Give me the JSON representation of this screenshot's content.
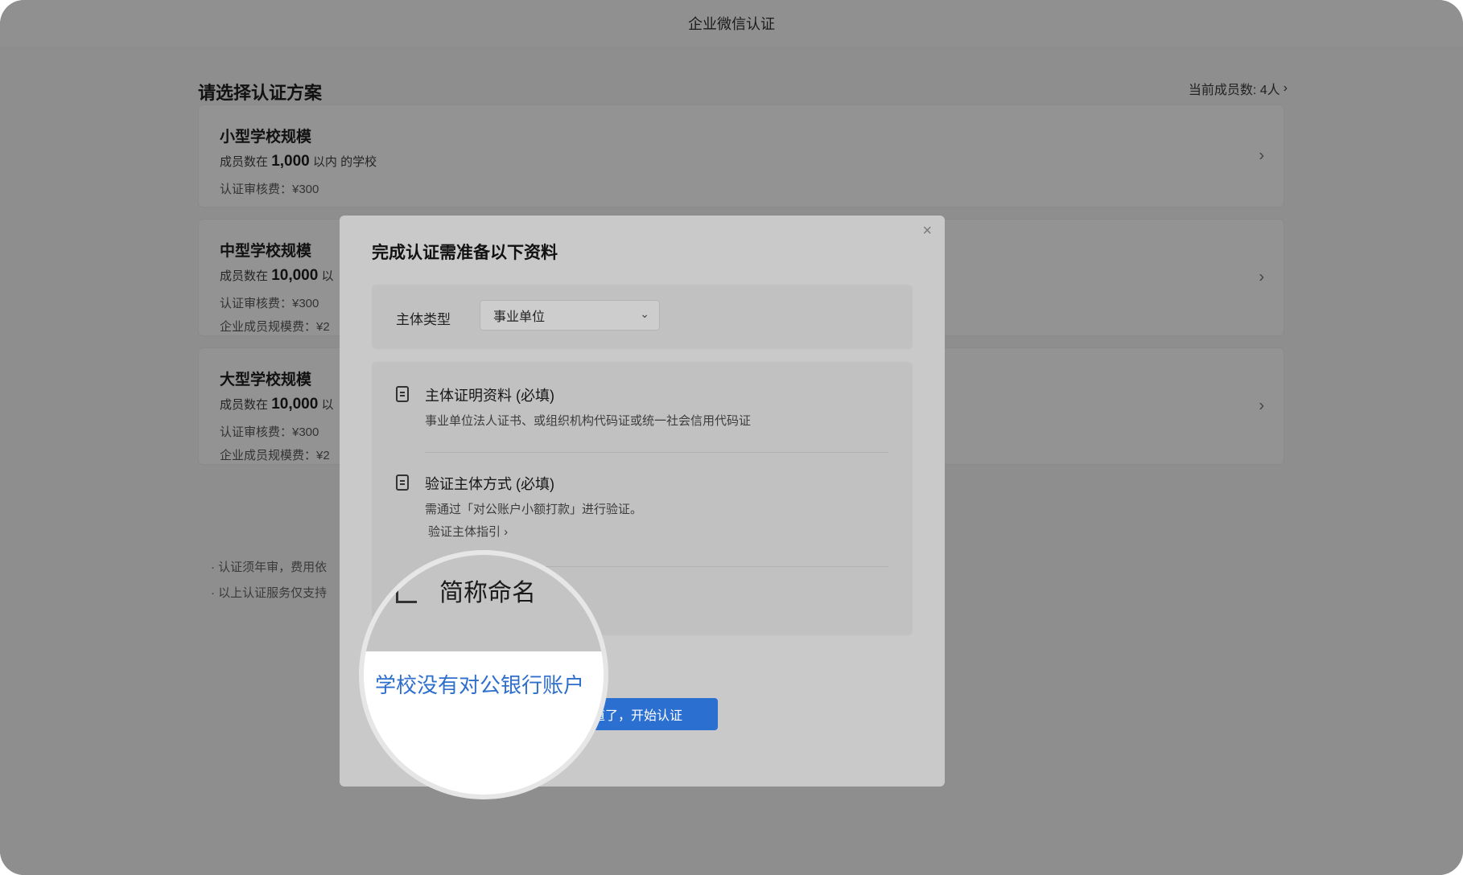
{
  "window": {
    "title": "企业微信认证"
  },
  "page": {
    "title": "请选择认证方案",
    "member_count": "当前成员数: 4人",
    "plans": [
      {
        "title": "小型学校规模",
        "desc_prefix": "成员数在",
        "desc_num": "1,000",
        "desc_suffix": "以内 的学校",
        "fee": "认证审核费：¥300",
        "fee2": ""
      },
      {
        "title": "中型学校规模",
        "desc_prefix": "成员数在",
        "desc_num": "10,000",
        "desc_suffix": "以",
        "fee": "认证审核费：¥300",
        "fee2": "企业成员规模费：¥2"
      },
      {
        "title": "大型学校规模",
        "desc_prefix": "成员数在",
        "desc_num": "10,000",
        "desc_suffix": "以",
        "fee": "认证审核费：¥300",
        "fee2": "企业成员规模费：¥2"
      }
    ],
    "notes": [
      "· 认证须年审，费用依",
      "· 以上认证服务仅支持"
    ]
  },
  "modal": {
    "title": "完成认证需准备以下资料",
    "close": "×",
    "type_label": "主体类型",
    "type_value": "事业单位",
    "requirements": [
      {
        "title": "主体证明资料 (必填)",
        "desc": "事业单位法人证书、或组织机构代码证或统一社会信用代码证",
        "link": ""
      },
      {
        "title": "验证主体方式 (必填)",
        "desc": "需通过「对公账户小额打款」进行验证。",
        "link": "验证主体指引 ›"
      }
    ],
    "confirm_button": "知道了，开始认证"
  },
  "magnifier": {
    "name_text": "简称命名",
    "link_text": "学校没有对公银行账户"
  }
}
